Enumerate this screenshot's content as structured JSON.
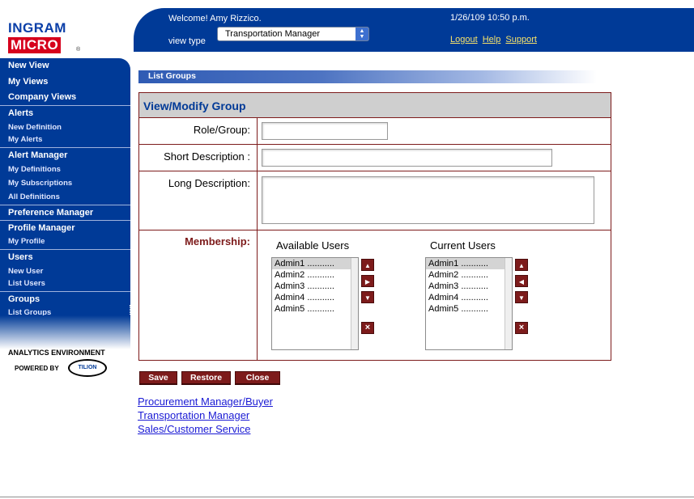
{
  "logo": {
    "line1": "INGRAM",
    "line2": "MICRO",
    "reg": "®"
  },
  "header": {
    "welcome": "Welcome! Amy Rizzico.",
    "view_type_label": "view type",
    "view_type_selected": "Transportation Manager",
    "datetime": "1/26/109 10:50 p.m.",
    "links": [
      "Logout",
      "Help",
      "Support"
    ]
  },
  "sidebar": {
    "new_view": "New View",
    "my_views": "My Views",
    "company_views": "Company Views",
    "alerts": "Alerts",
    "new_definition": "New Definition",
    "my_alerts": "My Alerts",
    "alert_manager": "Alert Manager",
    "my_definitions": "My Definitions",
    "my_subscriptions": "My Subscriptions",
    "all_definitions": "All Definitions",
    "preference_manager": "Preference Manager",
    "profile_manager": "Profile Manager",
    "my_profile": "My Profile",
    "users": "Users",
    "new_user": "New User",
    "list_users": "List Users",
    "groups": "Groups",
    "list_groups": "List Groups"
  },
  "branding": {
    "analytics": "ANALYTICS ENVIRONMENT",
    "powered_by": "POWERED BY",
    "tilion": "TILION"
  },
  "section_bar": "List Groups",
  "form": {
    "title": "View/Modify Group",
    "role_label": "Role/Group:",
    "role_value": "",
    "short_desc_label": "Short Description :",
    "short_desc_value": "",
    "long_desc_label": "Long Description:",
    "long_desc_value": "",
    "membership_label": "Membership:",
    "available_header": "Available Users",
    "current_header": "Current Users",
    "available_users": [
      "Admin1 ...........",
      "Admin2 ...........",
      "Admin3 ...........",
      "Admin4 ...........",
      "Admin5 ..........."
    ],
    "current_users": [
      "Admin1 ...........",
      "Admin2 ...........",
      "Admin3 ...........",
      "Admin4 ...........",
      "Admin5 ..........."
    ]
  },
  "buttons": {
    "save": "Save",
    "restore": "Restore",
    "close": "Close"
  },
  "bottom_links": [
    "Procurement Manager/Buyer",
    "Transportation Manager",
    "Sales/Customer Service"
  ],
  "colors": {
    "brand_blue": "#003a97",
    "maroon": "#7d1b1b",
    "logo_red": "#d6001c",
    "link_yellow": "#f6e26a"
  }
}
